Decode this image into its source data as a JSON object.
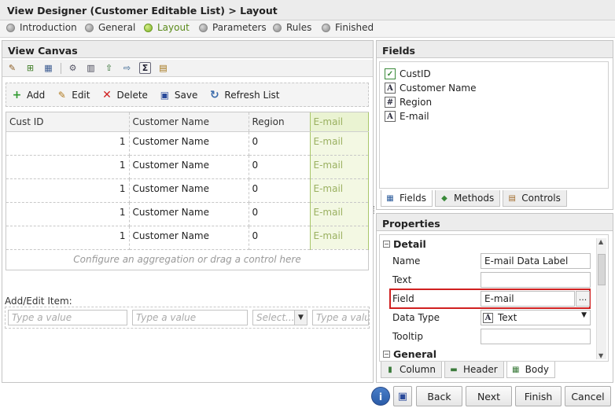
{
  "window": {
    "title": "View Designer (Customer Editable List) > Layout"
  },
  "steps": [
    {
      "label": "Introduction",
      "active": false
    },
    {
      "label": "General",
      "active": false
    },
    {
      "label": "Layout",
      "active": true
    },
    {
      "label": "Parameters",
      "active": false
    },
    {
      "label": "Rules",
      "active": false
    },
    {
      "label": "Finished",
      "active": false
    }
  ],
  "canvas": {
    "title": "View Canvas",
    "toolbar_icons": [
      "magic-wand-icon",
      "add-grid-icon",
      "edit-grid-icon",
      "gear-icon",
      "columns-icon",
      "insert-row-icon",
      "export-icon",
      "sigma-icon",
      "table-icon"
    ],
    "actions": [
      {
        "label": "Add",
        "icon": "plus-icon"
      },
      {
        "label": "Edit",
        "icon": "pencil-icon"
      },
      {
        "label": "Delete",
        "icon": "x-icon"
      },
      {
        "label": "Save",
        "icon": "floppy-icon"
      },
      {
        "label": "Refresh List",
        "icon": "refresh-icon"
      }
    ],
    "columns": [
      "Cust ID",
      "Customer Name",
      "Region",
      "E-mail"
    ],
    "rows": [
      [
        "1",
        "Customer Name",
        "0",
        "E-mail"
      ],
      [
        "1",
        "Customer Name",
        "0",
        "E-mail"
      ],
      [
        "1",
        "Customer Name",
        "0",
        "E-mail"
      ],
      [
        "1",
        "Customer Name",
        "0",
        "E-mail"
      ],
      [
        "1",
        "Customer Name",
        "0",
        "E-mail"
      ]
    ],
    "aggregation_hint": "Configure an aggregation or drag a control here",
    "add_edit_label": "Add/Edit Item:",
    "add_edit_inputs": [
      {
        "placeholder": "Type a value"
      },
      {
        "placeholder": "Type a value"
      },
      {
        "placeholder": "Select..."
      },
      {
        "placeholder": "Type a valu"
      }
    ]
  },
  "fields_panel": {
    "title": "Fields",
    "items": [
      {
        "label": "CustID",
        "icon": "key-check-icon"
      },
      {
        "label": "Customer Name",
        "icon": "text-a-icon"
      },
      {
        "label": "Region",
        "icon": "number-grid-icon"
      },
      {
        "label": "E-mail",
        "icon": "text-a-icon"
      }
    ],
    "tabs": [
      "Fields",
      "Methods",
      "Controls"
    ]
  },
  "properties_panel": {
    "title": "Properties",
    "section_detail": "Detail",
    "section_general": "General",
    "rows": [
      {
        "label": "Name",
        "value": "E-mail Data Label"
      },
      {
        "label": "Text",
        "value": ""
      },
      {
        "label": "Field",
        "value": "E-mail"
      },
      {
        "label": "Data Type",
        "value": "Text"
      },
      {
        "label": "Tooltip",
        "value": ""
      }
    ],
    "ellipsis": "...",
    "tabs": [
      "Column",
      "Header",
      "Body"
    ]
  },
  "footer": {
    "back": "Back",
    "next": "Next",
    "finish": "Finish",
    "cancel": "Cancel"
  },
  "colors": {
    "active_step": "#7fb228",
    "highlight_border": "#d02020",
    "selected_column": "#a9c76a"
  }
}
